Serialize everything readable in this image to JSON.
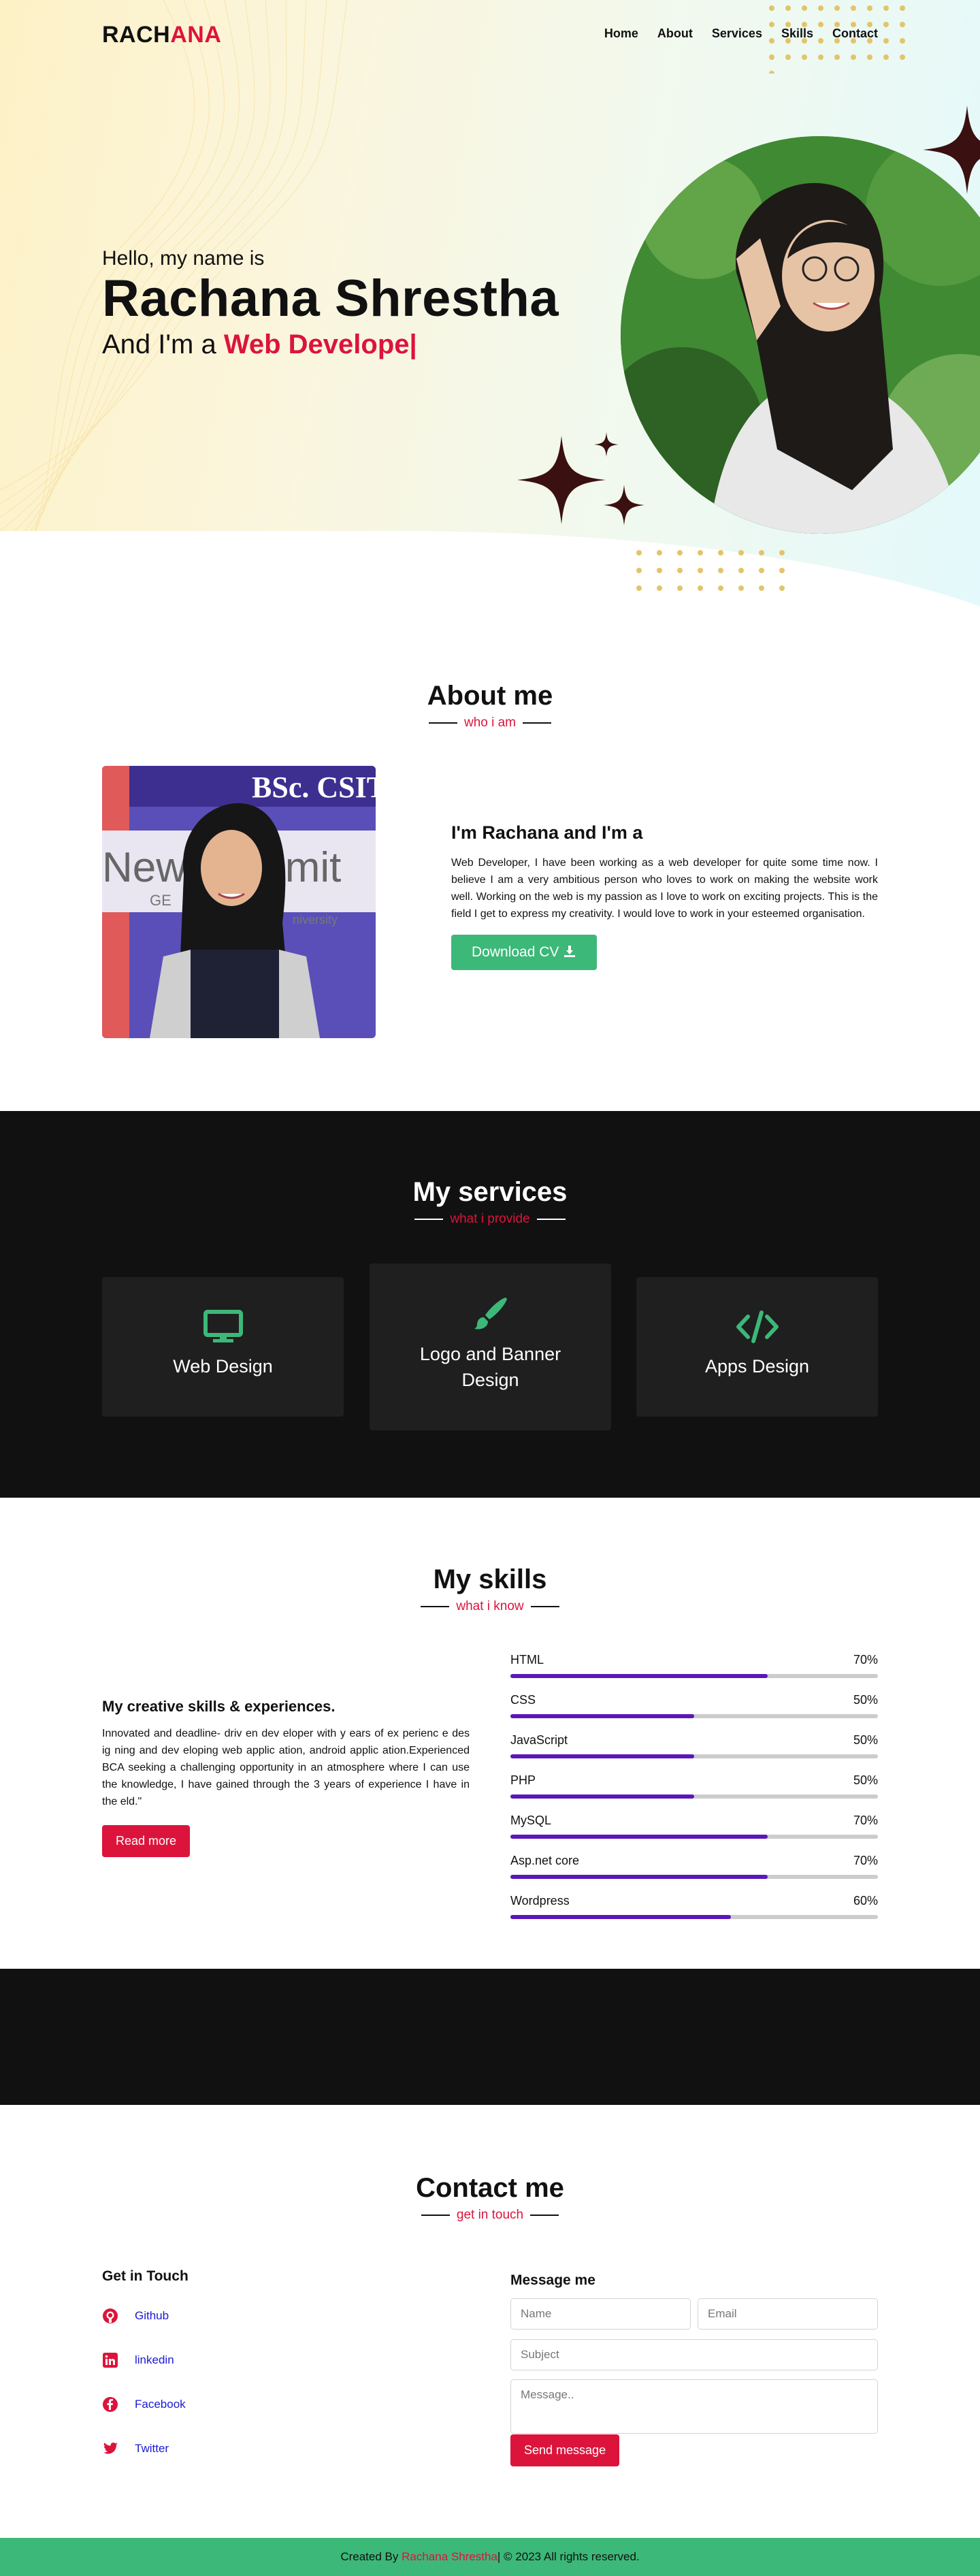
{
  "brand": {
    "prefix": "RACH",
    "accent": "ANA",
    "accent_color": "#dc143c"
  },
  "nav": {
    "items": [
      "Home",
      "About",
      "Services",
      "Skills",
      "Contact"
    ]
  },
  "hero": {
    "intro": "Hello, my name is",
    "name": "Rachana Shrestha",
    "role_prefix": "And I'm a ",
    "role_typed": "Web Develope",
    "cursor": "|"
  },
  "about": {
    "title": "About me",
    "subtitle": "who i am",
    "heading": "I'm Rachana and I'm a",
    "body": "Web Developer, I have been working as a web developer for quite some time now. I believe I am a very ambitious person who loves to work on making the website work well. Working on the web is my passion as I love to work on exciting projects. This is the field I get to express my creativity. I would love to work in your esteemed organisation.",
    "download_label": "Download CV",
    "download_icon": "download-icon",
    "photo_banner": "BSc. CSIT",
    "photo_banner2": "New Summit",
    "photo_text": "GE",
    "photo_text2": "niversity"
  },
  "services": {
    "title": "My services",
    "subtitle": "what i provide",
    "cards": [
      {
        "label": "Web Design",
        "icon": "monitor-icon"
      },
      {
        "label": "Logo and Banner Design",
        "icon": "paint-brush-icon"
      },
      {
        "label": "Apps Design",
        "icon": "code-icon"
      }
    ],
    "icon_color": "#3cb878"
  },
  "skills": {
    "title": "My skills",
    "subtitle": "what i know",
    "heading": "My creative skills & experiences.",
    "body": "Innovated and deadline- driv en dev eloper with y ears of ex perienc e des ig ning and dev eloping web applic ation, android applic ation.Experienced BCA seeking a challenging opportunity in an atmosphere where I can use the knowledge, I have gained through the 3 years of experience I have in the eld.\"",
    "read_more": "Read more",
    "items": [
      {
        "name": "HTML",
        "percent": "70%",
        "value": 70
      },
      {
        "name": "CSS",
        "percent": "50%",
        "value": 50
      },
      {
        "name": "JavaScript",
        "percent": "50%",
        "value": 50
      },
      {
        "name": "PHP",
        "percent": "50%",
        "value": 50
      },
      {
        "name": "MySQL",
        "percent": "70%",
        "value": 70
      },
      {
        "name": "Asp.net core",
        "percent": "70%",
        "value": 70
      },
      {
        "name": "Wordpress",
        "percent": "60%",
        "value": 60
      }
    ],
    "bar_color": "#5b17b8"
  },
  "contact": {
    "title": "Contact me",
    "subtitle": "get in touch",
    "get_in_touch": "Get in Touch",
    "social": [
      {
        "label": "Github",
        "icon": "github-icon"
      },
      {
        "label": "linkedin",
        "icon": "linkedin-icon"
      },
      {
        "label": "Facebook",
        "icon": "facebook-icon"
      },
      {
        "label": "Twitter",
        "icon": "twitter-icon"
      }
    ],
    "message_title": "Message me",
    "placeholders": {
      "name": "Name",
      "email": "Email",
      "subject": "Subject",
      "message": "Message.."
    },
    "send_label": "Send message"
  },
  "footer": {
    "prefix": "Created By ",
    "author": "Rachana Shrestha",
    "suffix": " | © 2023 All rights reserved."
  }
}
